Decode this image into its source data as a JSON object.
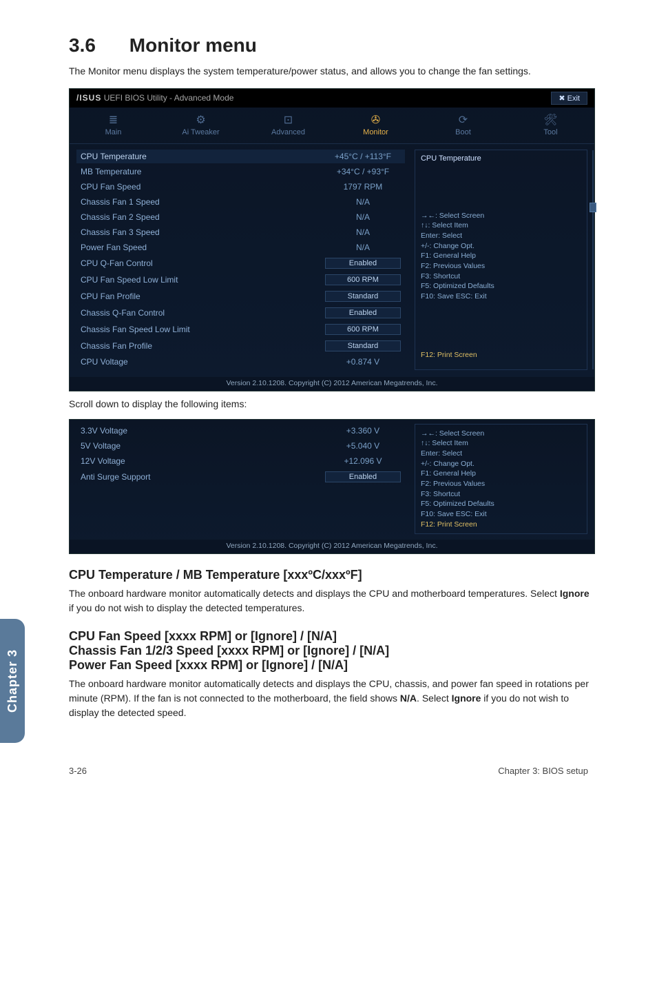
{
  "page": {
    "section_no": "3.6",
    "section_title": "Monitor menu",
    "intro": "The Monitor menu displays the system temperature/power status, and allows you to change the fan settings.",
    "scroll_note": "Scroll down to display the following items:",
    "footer_left": "3-26",
    "footer_right": "Chapter 3: BIOS setup",
    "side_tab": "Chapter 3"
  },
  "bios_top": {
    "brand": "/ISUS",
    "title": "UEFI BIOS Utility - Advanced Mode",
    "exit": "Exit",
    "tabs": [
      {
        "icon": "≣",
        "label": "Main"
      },
      {
        "icon": "⚙",
        "label": "Ai Tweaker"
      },
      {
        "icon": "⊡",
        "label": "Advanced"
      },
      {
        "icon": "✇",
        "label": "Monitor"
      },
      {
        "icon": "⟳",
        "label": "Boot"
      },
      {
        "icon": "🛠",
        "label": "Tool"
      }
    ],
    "rows": [
      {
        "label": "CPU Temperature",
        "value": "+45°C / +113°F",
        "sel": true
      },
      {
        "label": "MB Temperature",
        "value": "+34°C / +93°F"
      },
      {
        "label": "CPU Fan Speed",
        "value": "1797 RPM"
      },
      {
        "label": "Chassis Fan 1 Speed",
        "value": "N/A"
      },
      {
        "label": "Chassis Fan 2 Speed",
        "value": "N/A"
      },
      {
        "label": "Chassis Fan 3 Speed",
        "value": "N/A"
      },
      {
        "label": "Power Fan Speed",
        "value": "N/A"
      },
      {
        "label": "CPU Q-Fan Control",
        "value": "Enabled",
        "btn": true
      },
      {
        "label": "CPU Fan Speed Low Limit",
        "value": "600 RPM",
        "btn": true
      },
      {
        "label": "CPU Fan Profile",
        "value": "Standard",
        "btn": true
      },
      {
        "label": "Chassis Q-Fan Control",
        "value": "Enabled",
        "btn": true
      },
      {
        "label": "Chassis Fan Speed Low Limit",
        "value": "600 RPM",
        "btn": true
      },
      {
        "label": "Chassis Fan Profile",
        "value": "Standard",
        "btn": true
      },
      {
        "label": "CPU Voltage",
        "value": "+0.874 V"
      }
    ],
    "right_title": "CPU Temperature",
    "hints": "→←: Select Screen\n↑↓: Select Item\nEnter: Select\n+/-: Change Opt.\nF1: General Help\nF2: Previous Values\nF3: Shortcut\nF5: Optimized Defaults\nF10: Save  ESC: Exit",
    "hint_yellow": "F12: Print Screen",
    "footer": "Version 2.10.1208. Copyright (C) 2012 American Megatrends, Inc."
  },
  "bios_bottom": {
    "rows": [
      {
        "label": "3.3V Voltage",
        "value": "+3.360 V"
      },
      {
        "label": "5V Voltage",
        "value": "+5.040 V"
      },
      {
        "label": "12V Voltage",
        "value": "+12.096 V"
      },
      {
        "label": "Anti Surge Support",
        "value": "Enabled",
        "btn": true
      }
    ],
    "hints": "→←: Select Screen\n↑↓: Select Item\nEnter: Select\n+/-: Change Opt.\nF1: General Help\nF2: Previous Values\nF3: Shortcut\nF5: Optimized Defaults\nF10: Save  ESC: Exit",
    "hint_yellow": "F12: Print Screen",
    "footer": "Version 2.10.1208. Copyright (C) 2012 American Megatrends, Inc."
  },
  "sections": {
    "s1_title": "CPU Temperature / MB Temperature [xxxºC/xxxºF]",
    "s1_body_a": "The onboard hardware monitor automatically detects and displays the CPU and motherboard temperatures. Select ",
    "s1_body_b": "Ignore",
    "s1_body_c": " if you do not wish to display the detected temperatures.",
    "s2_l1": "CPU Fan Speed [xxxx RPM] or [Ignore] / [N/A]",
    "s2_l2": "Chassis Fan 1/2/3 Speed [xxxx RPM] or [Ignore] / [N/A]",
    "s2_l3": "Power Fan Speed [xxxx RPM] or [Ignore] / [N/A]",
    "s2_body_a": "The onboard hardware monitor automatically detects and displays the CPU, chassis, and power fan speed in rotations per minute (RPM). If the fan is not connected to the motherboard, the field shows ",
    "s2_body_b": "N/A",
    "s2_body_c": ". Select ",
    "s2_body_d": "Ignore",
    "s2_body_e": " if you do not wish to display the detected speed."
  }
}
